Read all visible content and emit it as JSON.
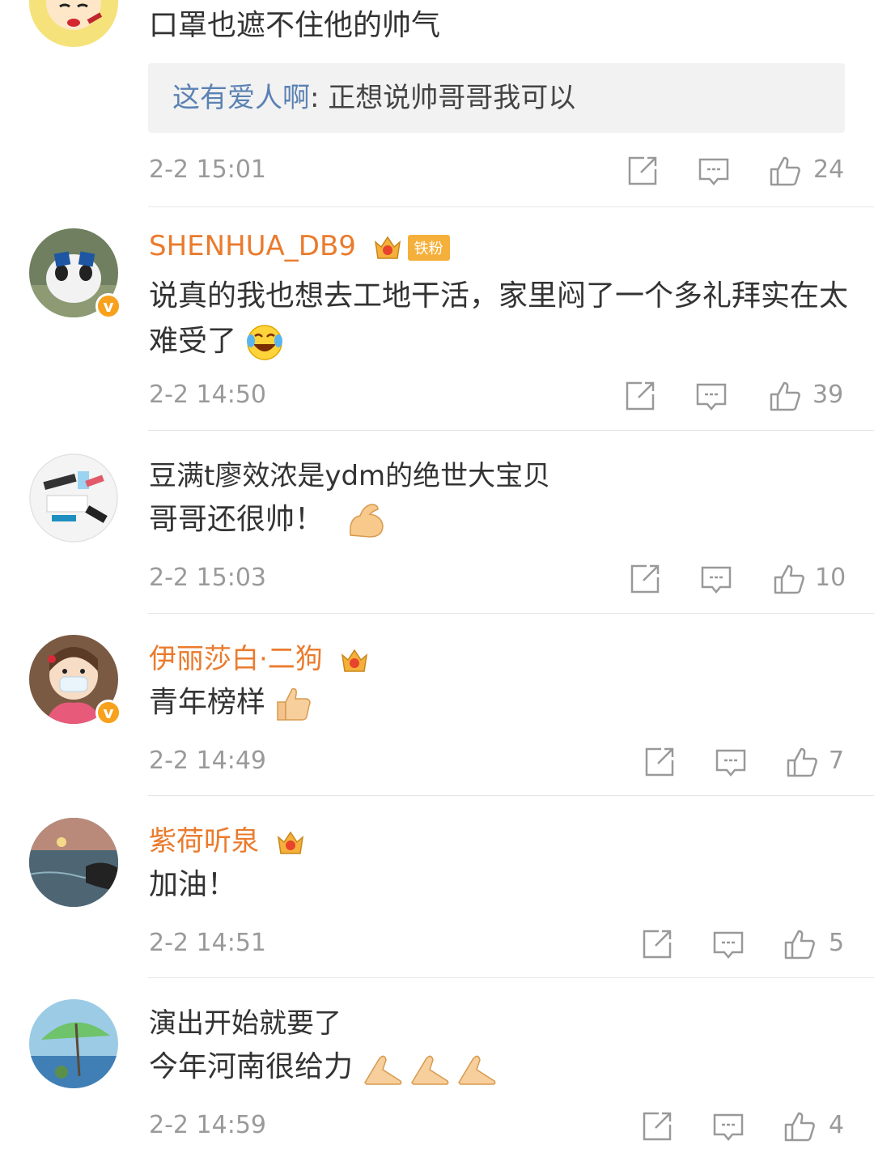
{
  "comments": [
    {
      "username": "",
      "text": "口罩也遮不住他的帅气",
      "reply_user": "这有爱人啊",
      "reply_text": ": 正想说帅哥哥我可以",
      "time": "2-2 15:01",
      "likes": "24",
      "verified": false
    },
    {
      "username": "SHENHUA_DB9",
      "fan_tag": "铁粉",
      "text": "说真的我也想去工地干活，家里闷了一个多礼拜实在太难受了",
      "time": "2-2 14:50",
      "likes": "39",
      "verified": true
    },
    {
      "username": "豆满t廖效浓是ydm的绝世大宝贝",
      "text": "哥哥还很帅！",
      "time": "2-2 15:03",
      "likes": "10",
      "verified": false
    },
    {
      "username": "伊丽莎白·二狗",
      "text": "青年榜样",
      "time": "2-2 14:49",
      "likes": "7",
      "verified": true
    },
    {
      "username": "紫荷听泉",
      "text": "加油！",
      "time": "2-2 14:51",
      "likes": "5",
      "verified": false
    },
    {
      "username": "演出开始就要了",
      "text": "今年河南很给力",
      "time": "2-2 14:59",
      "likes": "4",
      "verified": false
    }
  ],
  "icons": {
    "share": "share-icon",
    "comment": "comment-icon",
    "like": "thumbs-up-icon",
    "crown": "crown-badge-icon",
    "verified": "verified-v-icon"
  },
  "colors": {
    "username": "#ea7b2d",
    "reply_name": "#5b82b4",
    "meta": "#9a9a9a",
    "badge": "#f7a11c"
  }
}
